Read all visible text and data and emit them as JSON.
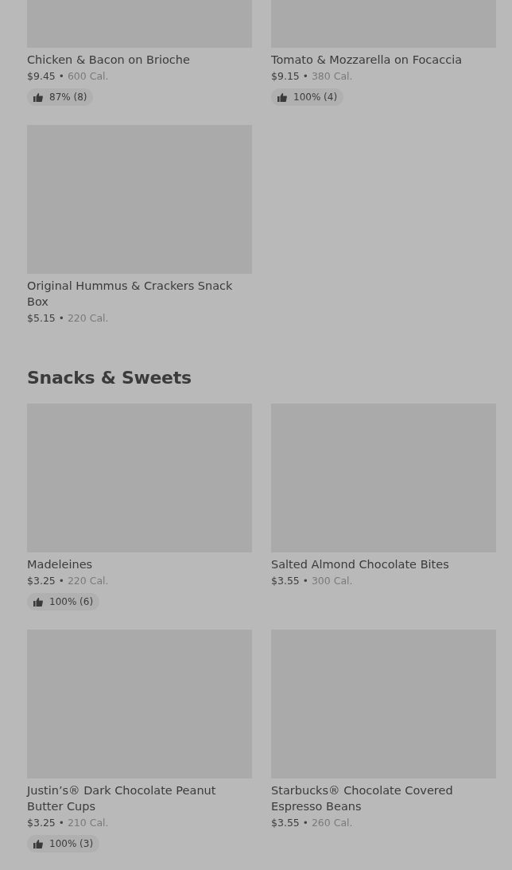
{
  "sections": [
    {
      "items": [
        {
          "name": "Chicken & Bacon on Brioche",
          "price": "$9.45",
          "separator": "•",
          "calories": "600 Cal.",
          "rating": "87% (8)"
        },
        {
          "name": "Tomato & Mozzarella on Focaccia",
          "price": "$9.15",
          "separator": "•",
          "calories": "380 Cal.",
          "rating": "100% (4)"
        },
        {
          "name": "Original Hummus & Crackers Snack Box",
          "price": "$5.15",
          "separator": "•",
          "calories": "220 Cal."
        }
      ]
    },
    {
      "title": "Snacks & Sweets",
      "items": [
        {
          "name": "Madeleines",
          "price": "$3.25",
          "separator": "•",
          "calories": "220 Cal.",
          "rating": "100% (6)"
        },
        {
          "name": "Salted Almond Chocolate Bites",
          "price": "$3.55",
          "separator": "•",
          "calories": "300 Cal."
        },
        {
          "name": "Justin’s® Dark Chocolate Peanut Butter Cups",
          "price": "$3.25",
          "separator": "•",
          "calories": "210 Cal.",
          "rating": "100% (3)"
        },
        {
          "name": "Starbucks® Chocolate Covered Espresso Beans",
          "price": "$3.55",
          "separator": "•",
          "calories": "260 Cal."
        }
      ]
    }
  ]
}
